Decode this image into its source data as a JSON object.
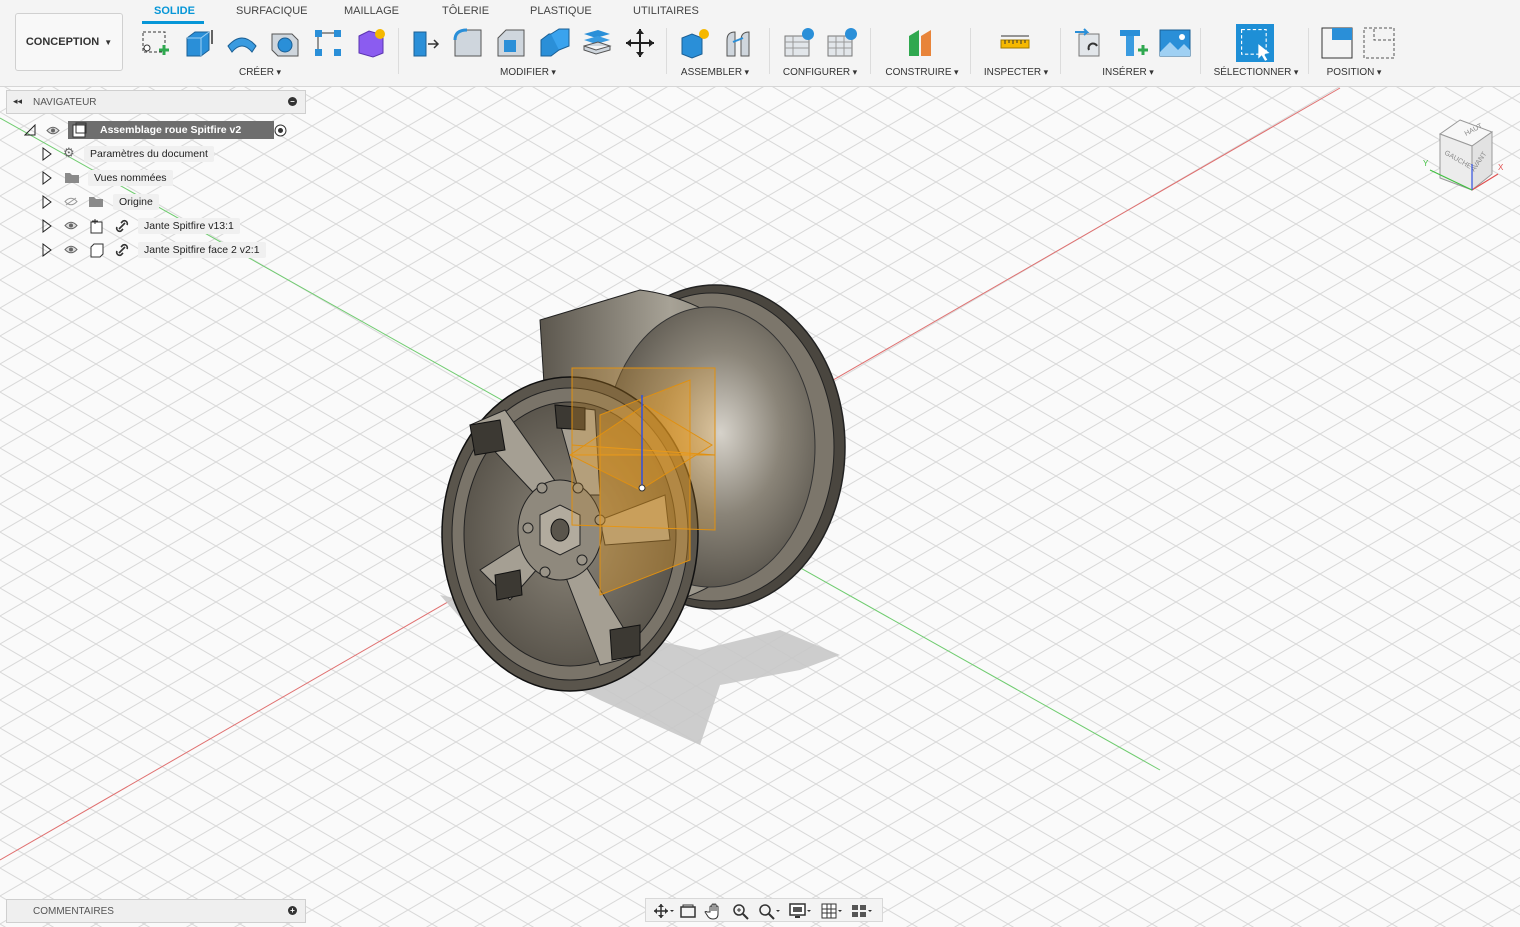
{
  "toolbar": {
    "tabs": [
      "SOLIDE",
      "SURFACIQUE",
      "MAILLAGE",
      "TÔLERIE",
      "PLASTIQUE",
      "UTILITAIRES"
    ],
    "workspace": "CONCEPTION",
    "groups": [
      "CRÉER",
      "MODIFIER",
      "ASSEMBLER",
      "CONFIGURER",
      "CONSTRUIRE",
      "INSPECTER",
      "INSÉRER",
      "SÉLECTIONNER",
      "POSITION"
    ]
  },
  "navigator": {
    "title": "NAVIGATEUR",
    "root": "Assemblage roue Spitfire v2",
    "items": [
      "Paramètres du document",
      "Vues nommées",
      "Origine",
      "Jante Spitfire v13:1",
      "Jante Spitfire face 2 v2:1"
    ]
  },
  "comments": {
    "title": "COMMENTAIRES"
  },
  "viewcube": {
    "top": "HAUT",
    "left": "GAUCHE",
    "front": "AVANT"
  },
  "colors": {
    "accent": "#0696d7",
    "axis_x": "#e05050",
    "axis_y": "#40c040",
    "axis_z": "#3050e0",
    "origin_plane": "#f0a020",
    "rim": "#6f685c"
  }
}
